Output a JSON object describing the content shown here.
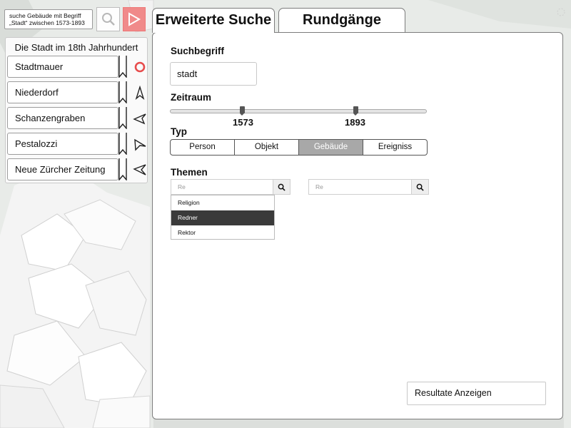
{
  "search": {
    "query_line1": "suche Gebäude mit Begriff",
    "query_line2": "„Stadt“ zwischen 1573-1893"
  },
  "tours": {
    "title": "Die Stadt im 18th Jahrhundert",
    "items": [
      {
        "label": "Stadtmauer",
        "icon": "record-icon"
      },
      {
        "label": "Niederdorf",
        "icon": "navigation-arrow-up-icon"
      },
      {
        "label": "Schanzengraben",
        "icon": "navigation-arrow-left-icon"
      },
      {
        "label": "Pestalozzi",
        "icon": "navigation-arrow-left-icon"
      },
      {
        "label": "Neue Zürcher Zeitung",
        "icon": "navigation-arrow-left-icon"
      }
    ]
  },
  "tabs": {
    "active": "Erweiterte Suche",
    "inactive": "Rundgänge"
  },
  "form": {
    "search_term_label": "Suchbegriff",
    "search_term_value": "stadt",
    "time_label": "Zeitraum",
    "time_min": "1573",
    "time_max": "1893",
    "type_label": "Typ",
    "types": [
      "Person",
      "Objekt",
      "Gebäude",
      "Ereigniss"
    ],
    "selected_type": "Gebäude",
    "themes_label": "Themen",
    "theme_input_1": "Re",
    "theme_input_2": "Re",
    "suggestions": [
      "Religion",
      "Redner",
      "Rektor"
    ],
    "selected_suggestion": "Redner"
  },
  "actions": {
    "show_results": "Resultate Anzeigen"
  },
  "colors": {
    "accent_red": "#f08a8a",
    "selected_type_bg": "#a8a8a8",
    "selected_suggestion_bg": "#3a3a3a"
  }
}
